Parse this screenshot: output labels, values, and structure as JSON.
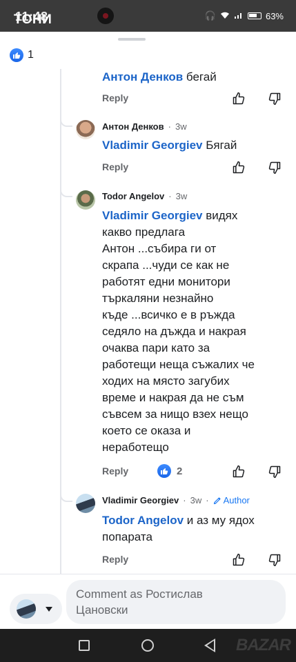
{
  "status_bar": {
    "time": "11:48",
    "battery": "63%"
  },
  "watermark": "ТОНИ",
  "reactions_summary": {
    "count": "1"
  },
  "comments": [
    {
      "mention": "Антон Денков",
      "text": "бегай",
      "reply_label": "Reply"
    },
    {
      "author": "Антон Денков",
      "time": "3w",
      "mention": "Vladimir Georgiev",
      "text": "Бягай",
      "reply_label": "Reply"
    },
    {
      "author": "Todor Angelov",
      "time": "3w",
      "mention": "Vladimir Georgiev",
      "lines": [
        "видях",
        "какво предлага",
        "Антон ...събира ги от",
        "скрапа ...чуди се как не",
        "работят едни монитори",
        "търкаляни незнайно",
        "къде ...всичко е в ръжда",
        "седяло на дъжда и накрая",
        "очаква пари като за",
        "работещи неща съжалих че",
        "ходих на място загубих",
        "време и накрая да не съм",
        "съвсем за нищо взех нещо",
        "което се оказа и",
        "неработещо"
      ],
      "reply_label": "Reply",
      "reaction_count": "2"
    },
    {
      "author": "Vladimir Georgiev",
      "time": "3w",
      "badge": "Author",
      "mention": "Todor Angelov",
      "lines": [
        "и аз му ядох",
        "попарата"
      ],
      "reply_label": "Reply"
    }
  ],
  "composer": {
    "placeholder_line1": "Comment as Ростислав",
    "placeholder_line2": "Цановски"
  },
  "bazar_logo": "BAZAR"
}
